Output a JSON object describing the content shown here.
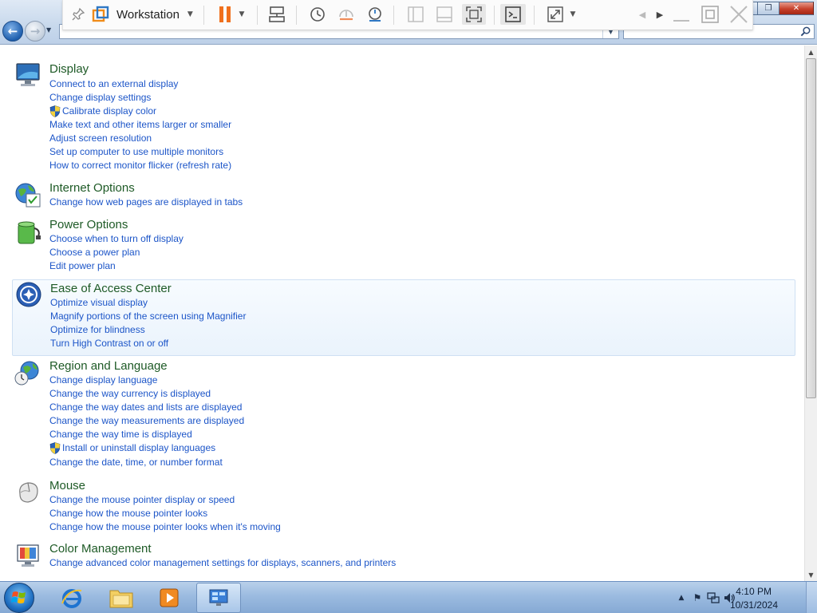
{
  "toolbar": {
    "title": "Workstation"
  },
  "categories": [
    {
      "title": "Display",
      "links": [
        {
          "label": "Connect to an external display",
          "shield": false
        },
        {
          "label": "Change display settings",
          "shield": false
        },
        {
          "label": "Calibrate display color",
          "shield": true
        },
        {
          "label": "Make text and other items larger or smaller",
          "shield": false
        },
        {
          "label": "Adjust screen resolution",
          "shield": false
        },
        {
          "label": "Set up computer to use multiple monitors",
          "shield": false
        },
        {
          "label": "How to correct monitor flicker (refresh rate)",
          "shield": false
        }
      ]
    },
    {
      "title": "Internet Options",
      "links": [
        {
          "label": "Change how web pages are displayed in tabs",
          "shield": false
        }
      ]
    },
    {
      "title": "Power Options",
      "links": [
        {
          "label": "Choose when to turn off display",
          "shield": false
        },
        {
          "label": "Choose a power plan",
          "shield": false
        },
        {
          "label": "Edit power plan",
          "shield": false
        }
      ]
    },
    {
      "title": "Ease of Access Center",
      "links": [
        {
          "label": "Optimize visual display",
          "shield": false
        },
        {
          "label": "Magnify portions of the screen using Magnifier",
          "shield": false
        },
        {
          "label": "Optimize for blindness",
          "shield": false
        },
        {
          "label": "Turn High Contrast on or off",
          "shield": false
        }
      ]
    },
    {
      "title": "Region and Language",
      "links": [
        {
          "label": "Change display language",
          "shield": false
        },
        {
          "label": "Change the way currency is displayed",
          "shield": false
        },
        {
          "label": "Change the way dates and lists are displayed",
          "shield": false
        },
        {
          "label": "Change the way measurements are displayed",
          "shield": false
        },
        {
          "label": "Change the way time is displayed",
          "shield": false
        },
        {
          "label": "Install or uninstall display languages",
          "shield": true
        },
        {
          "label": "Change the date, time, or number format",
          "shield": false
        }
      ]
    },
    {
      "title": "Mouse",
      "links": [
        {
          "label": "Change the mouse pointer display or speed",
          "shield": false
        },
        {
          "label": "Change how the mouse pointer looks",
          "shield": false
        },
        {
          "label": "Change how the mouse pointer looks when it's moving",
          "shield": false
        }
      ]
    },
    {
      "title": "Color Management",
      "links": [
        {
          "label": "Change advanced color management settings for displays, scanners, and printers",
          "shield": false
        }
      ]
    }
  ],
  "taskbar": {
    "time": "4:10 PM",
    "date": "10/31/2024"
  },
  "colors": {
    "link": "#1c55c8",
    "category_title": "#1e5a26",
    "highlight_border": "#cfe0f3"
  }
}
